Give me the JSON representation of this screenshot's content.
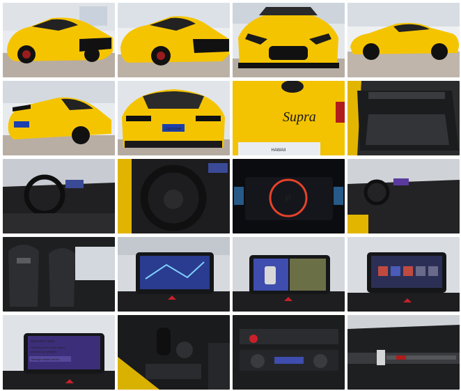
{
  "gallery": {
    "photos": [
      {
        "subject": "front three-quarter view, yellow Toyota GR Supra, showroom"
      },
      {
        "subject": "front three-quarter view, closer angle"
      },
      {
        "subject": "front view"
      },
      {
        "subject": "side profile view"
      },
      {
        "subject": "rear three-quarter view with rear spoiler"
      },
      {
        "subject": "rear view"
      },
      {
        "subject": "Supra badge close-up on rear"
      },
      {
        "subject": "rear cargo area"
      },
      {
        "subject": "dashboard and steering wheel"
      },
      {
        "subject": "steering wheel close-up"
      },
      {
        "subject": "digital instrument cluster"
      },
      {
        "subject": "interior from passenger side"
      },
      {
        "subject": "sport seats"
      },
      {
        "subject": "infotainment map screen"
      },
      {
        "subject": "infotainment camera view"
      },
      {
        "subject": "infotainment menu screen"
      },
      {
        "subject": "infotainment notification screen"
      },
      {
        "subject": "gear selector and center console"
      },
      {
        "subject": "climate control panel"
      },
      {
        "subject": "passenger dash trim"
      }
    ],
    "badges": {
      "rear_plate": "carousel",
      "rear_script": "Supra",
      "cluster_gear": "P",
      "dealer_plate": "HAWAII",
      "notif_title": "Bluetooth® audio",
      "notif_line1": "No Bluetooth® audio device",
      "notif_line2": "detected or available",
      "notif_btn": "Manage mobile device"
    },
    "colors": {
      "car_yellow": "#f5c400",
      "floor": "#b9aea3",
      "interior": "#1f1f21",
      "screen_blue": "#2a3c8f"
    }
  }
}
